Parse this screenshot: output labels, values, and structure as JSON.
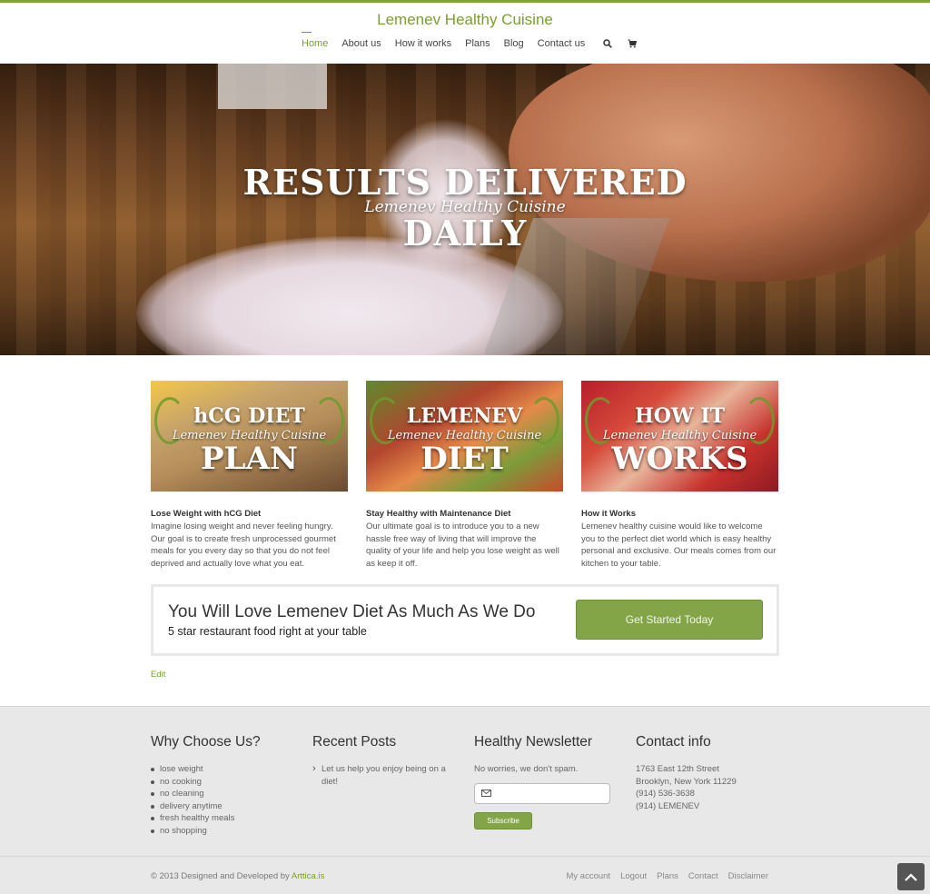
{
  "header": {
    "site_title": "Lemenev Healthy Cuisine",
    "nav": [
      "Home",
      "About us",
      "How it works",
      "Plans",
      "Blog",
      "Contact us"
    ],
    "active_item": "Home",
    "icons": [
      "search-icon",
      "cart-icon"
    ],
    "accent_color": "#7a9e31"
  },
  "hero": {
    "line1": "RESULTS DELIVERED",
    "line2": "Lemenev Healthy Cuisine",
    "line3": "DAILY"
  },
  "features": [
    {
      "image_top": "hCG DIET",
      "image_mid": "Lemenev Healthy Cuisine",
      "image_bottom": "PLAN",
      "title": "Lose Weight with hCG Diet",
      "text": "Imagine losing weight and never feeling hungry. Our goal is to create fresh unprocessed gourmet meals for you every day so that you do not feel deprived and actually love what you eat."
    },
    {
      "image_top": "LEMENEV",
      "image_mid": "Lemenev Healthy Cuisine",
      "image_bottom": "DIET",
      "title": "Stay Healthy with Maintenance Diet",
      "text": "Our ultimate goal is to introduce you to a new hassle free way of living that will improve the quality of your life and help you lose weight as well as keep it off."
    },
    {
      "image_top": "HOW IT",
      "image_mid": "Lemenev Healthy Cuisine",
      "image_bottom": "WORKS",
      "title": "How it Works",
      "text": "Lemenev healthy cuisine would like to welcome you to the perfect diet world which is easy healthy personal and exclusive. Our meals comes from our kitchen to your table."
    }
  ],
  "cta": {
    "heading": "You Will Love Lemenev Diet As Much As We Do",
    "subheading": "5 star restaurant food right at your table",
    "button": "Get Started Today",
    "button_color": "#84a547"
  },
  "edit_link": "Edit",
  "footer": {
    "why": {
      "title": "Why Choose Us?",
      "items": [
        "lose weight",
        "no cooking",
        "no cleaning",
        "delivery anytime",
        "fresh healthy meals",
        "no shopping"
      ]
    },
    "recent": {
      "title": "Recent Posts",
      "items": [
        "Let us help you enjoy being on a diet!"
      ]
    },
    "newsletter": {
      "title": "Healthy Newsletter",
      "text": "No worries, we don't spam.",
      "input_placeholder": "",
      "button": "Subscribe"
    },
    "contact": {
      "title": "Contact info",
      "lines": [
        "1763 East 12th Street",
        "Brooklyn, New York 11229",
        "(914) 536-3638",
        "(914) LEMENEV"
      ]
    },
    "copyright_prefix": "© 2013 Designed and Developed by ",
    "copyright_link": "Arttica.is",
    "links": [
      "My account",
      "Logout",
      "Plans",
      "Contact",
      "Disclaimer"
    ]
  }
}
